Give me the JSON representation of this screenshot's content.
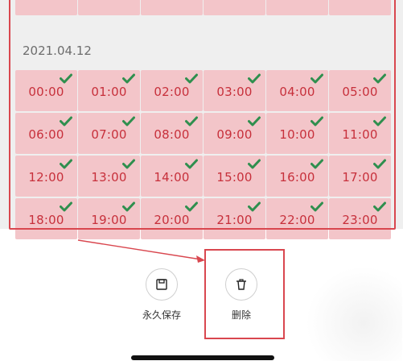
{
  "date_label": "2021.04.12",
  "time_slots": [
    {
      "time": "00:00",
      "selected": true
    },
    {
      "time": "01:00",
      "selected": true
    },
    {
      "time": "02:00",
      "selected": true
    },
    {
      "time": "03:00",
      "selected": true
    },
    {
      "time": "04:00",
      "selected": true
    },
    {
      "time": "05:00",
      "selected": true
    },
    {
      "time": "06:00",
      "selected": true
    },
    {
      "time": "07:00",
      "selected": true
    },
    {
      "time": "08:00",
      "selected": true
    },
    {
      "time": "09:00",
      "selected": true
    },
    {
      "time": "10:00",
      "selected": true
    },
    {
      "time": "11:00",
      "selected": true
    },
    {
      "time": "12:00",
      "selected": true
    },
    {
      "time": "13:00",
      "selected": true
    },
    {
      "time": "14:00",
      "selected": true
    },
    {
      "time": "15:00",
      "selected": true
    },
    {
      "time": "16:00",
      "selected": true
    },
    {
      "time": "17:00",
      "selected": true
    },
    {
      "time": "18:00",
      "selected": true
    },
    {
      "time": "19:00",
      "selected": true
    },
    {
      "time": "20:00",
      "selected": true
    },
    {
      "time": "21:00",
      "selected": true
    },
    {
      "time": "22:00",
      "selected": true
    },
    {
      "time": "23:00",
      "selected": true
    }
  ],
  "actions": {
    "save_label": "永久保存",
    "delete_label": "删除"
  },
  "colors": {
    "cell_bg": "#f3c5c9",
    "time_text": "#c7303b",
    "check": "#2f8f4e",
    "annotation_red": "#d9474f"
  }
}
